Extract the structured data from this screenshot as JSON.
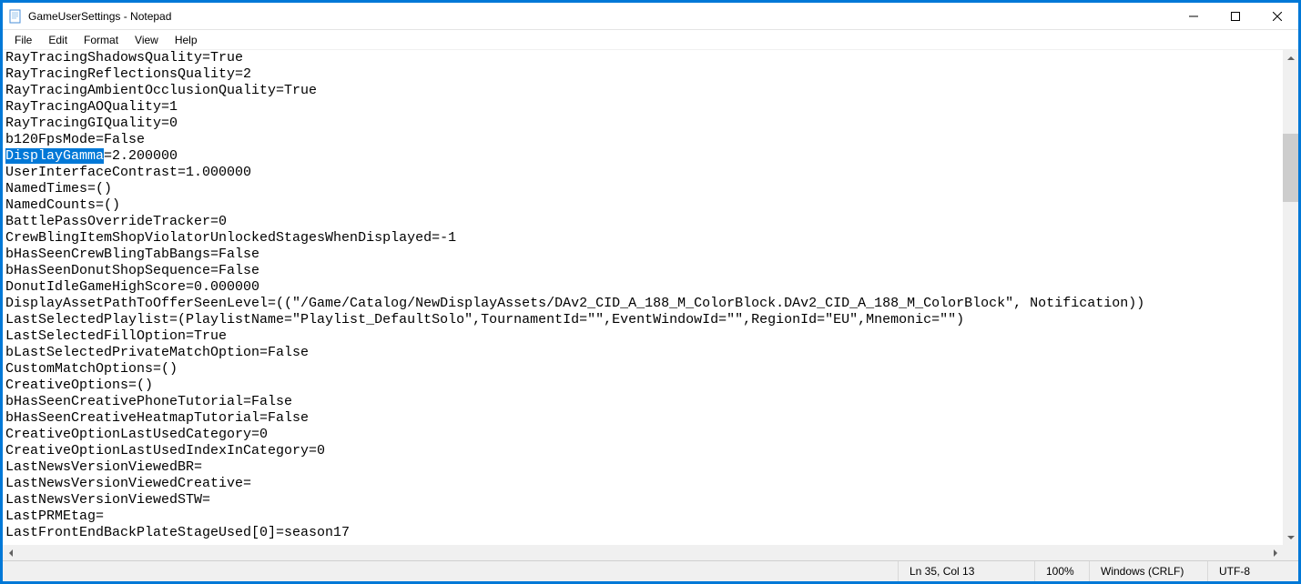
{
  "window": {
    "title": "GameUserSettings - Notepad"
  },
  "menu": {
    "file": "File",
    "edit": "Edit",
    "format": "Format",
    "view": "View",
    "help": "Help"
  },
  "editor": {
    "selected_text": "DisplayGamma",
    "selected_suffix": "=2.200000",
    "lines": [
      "RayTracingShadowsQuality=True",
      "RayTracingReflectionsQuality=2",
      "RayTracingAmbientOcclusionQuality=True",
      "RayTracingAOQuality=1",
      "RayTracingGIQuality=0",
      "b120FpsMode=False",
      "__SELECTED__",
      "UserInterfaceContrast=1.000000",
      "NamedTimes=()",
      "NamedCounts=()",
      "BattlePassOverrideTracker=0",
      "CrewBlingItemShopViolatorUnlockedStagesWhenDisplayed=-1",
      "bHasSeenCrewBlingTabBangs=False",
      "bHasSeenDonutShopSequence=False",
      "DonutIdleGameHighScore=0.000000",
      "DisplayAssetPathToOfferSeenLevel=((\"/Game/Catalog/NewDisplayAssets/DAv2_CID_A_188_M_ColorBlock.DAv2_CID_A_188_M_ColorBlock\", Notification))",
      "LastSelectedPlaylist=(PlaylistName=\"Playlist_DefaultSolo\",TournamentId=\"\",EventWindowId=\"\",RegionId=\"EU\",Mnemonic=\"\")",
      "LastSelectedFillOption=True",
      "bLastSelectedPrivateMatchOption=False",
      "CustomMatchOptions=()",
      "CreativeOptions=()",
      "bHasSeenCreativePhoneTutorial=False",
      "bHasSeenCreativeHeatmapTutorial=False",
      "CreativeOptionLastUsedCategory=0",
      "CreativeOptionLastUsedIndexInCategory=0",
      "LastNewsVersionViewedBR=",
      "LastNewsVersionViewedCreative=",
      "LastNewsVersionViewedSTW=",
      "LastPRMEtag=",
      "LastFrontEndBackPlateStageUsed[0]=season17"
    ]
  },
  "status": {
    "position": "Ln 35, Col 13",
    "zoom": "100%",
    "line_ending": "Windows (CRLF)",
    "encoding": "UTF-8"
  }
}
